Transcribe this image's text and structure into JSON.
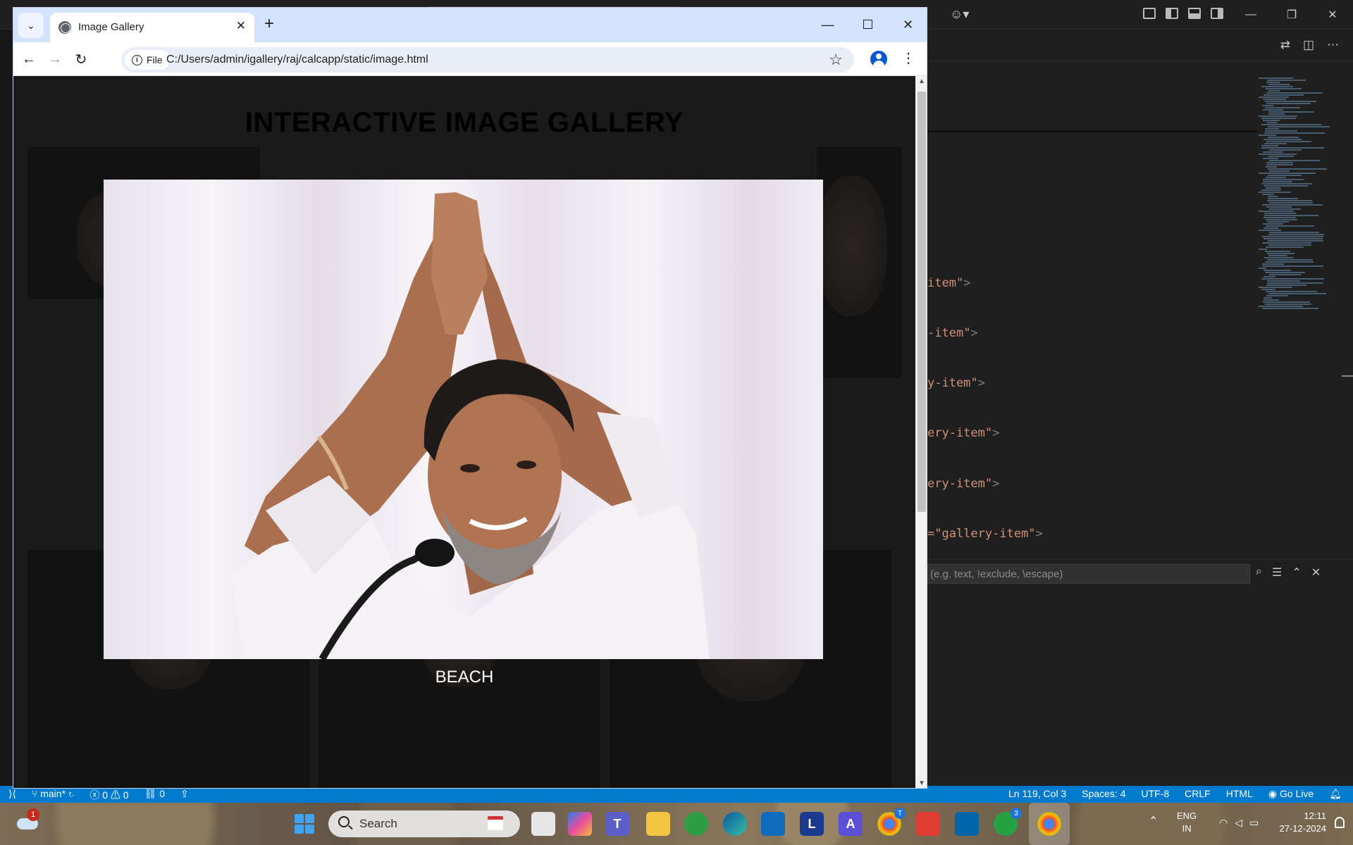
{
  "vscode": {
    "code_lines": [
      {
        "prefix": "item",
        "suffix": ">"
      },
      {
        "prefix": "-item",
        "suffix": ">"
      },
      {
        "prefix": "y-item",
        "suffix": ">"
      },
      {
        "prefix": "ery-item",
        "suffix": ">"
      },
      {
        "prefix": "ery-item",
        "suffix": ">"
      },
      {
        "prefix": "=\"gallery-item",
        "suffix": ">"
      }
    ],
    "find_placeholder": "(e.g. text, !exclude, \\escape)",
    "status_left": {
      "branch": "main*",
      "errors": "0",
      "warnings": "0",
      "ports": "0"
    },
    "status_right": {
      "position": "Ln 119, Col 3",
      "spaces": "Spaces: 4",
      "encoding": "UTF-8",
      "eol": "CRLF",
      "language": "HTML",
      "golive": "Go Live"
    }
  },
  "browser": {
    "tab_title": "Image Gallery",
    "site_info_label": "File",
    "url": "C:/Users/admin/igallery/raj/calcapp/static/image.html"
  },
  "page": {
    "title": "INTERACTIVE IMAGE GALLERY",
    "caption": "BEACH"
  },
  "taskbar": {
    "weather_badge": "1",
    "search_label": "Search",
    "teams_badge": "T",
    "whatsapp_badge": "3",
    "language": {
      "line1": "ENG",
      "line2": "IN"
    },
    "time": "12:11",
    "date": "27-12-2024"
  },
  "colors": {
    "statusbar": "#007acc",
    "page_bg": "#1a1a1a",
    "tabstrip": "#d3e3fd",
    "code_string": "#ce9178"
  }
}
